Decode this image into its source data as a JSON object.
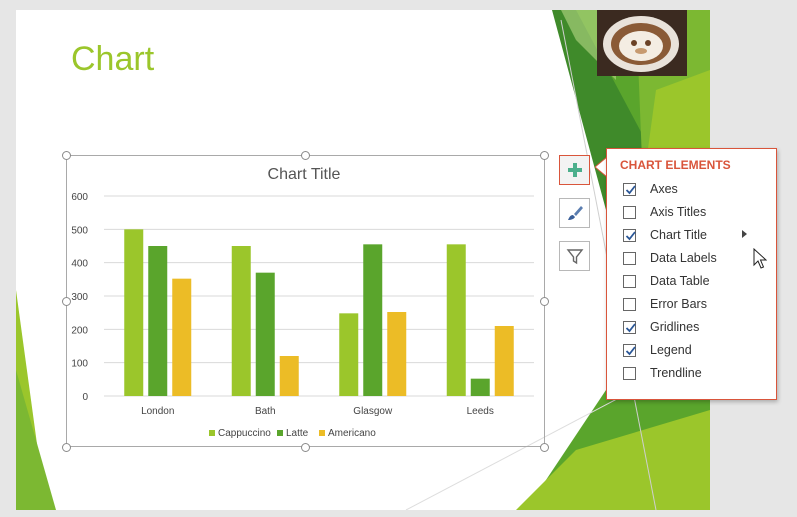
{
  "slide": {
    "title": "Chart"
  },
  "chart_data": {
    "type": "bar",
    "title": "Chart Title",
    "categories": [
      "London",
      "Bath",
      "Glasgow",
      "Leeds"
    ],
    "series": [
      {
        "name": "Cappuccino",
        "color": "#9bc62b",
        "values": [
          500,
          450,
          248,
          455
        ]
      },
      {
        "name": "Latte",
        "color": "#5aa52c",
        "values": [
          450,
          370,
          455,
          52
        ]
      },
      {
        "name": "Americano",
        "color": "#ecbc26",
        "values": [
          352,
          120,
          252,
          210
        ]
      }
    ],
    "ylim": [
      0,
      600
    ],
    "yticks": [
      0,
      100,
      200,
      300,
      400,
      500,
      600
    ],
    "grid": true,
    "legend": "bottom"
  },
  "chart_tools": {
    "add_icon": "plus-icon",
    "style_icon": "paintbrush-icon",
    "filter_icon": "filter-icon"
  },
  "chart_elements": {
    "title": "CHART ELEMENTS",
    "accent": "#d9553b",
    "options": [
      {
        "label": "Axes",
        "checked": true
      },
      {
        "label": "Axis Titles",
        "checked": false
      },
      {
        "label": "Chart Title",
        "checked": true
      },
      {
        "label": "Data Labels",
        "checked": false
      },
      {
        "label": "Data Table",
        "checked": false
      },
      {
        "label": "Error Bars",
        "checked": false
      },
      {
        "label": "Gridlines",
        "checked": true
      },
      {
        "label": "Legend",
        "checked": true
      },
      {
        "label": "Trendline",
        "checked": false
      }
    ]
  }
}
